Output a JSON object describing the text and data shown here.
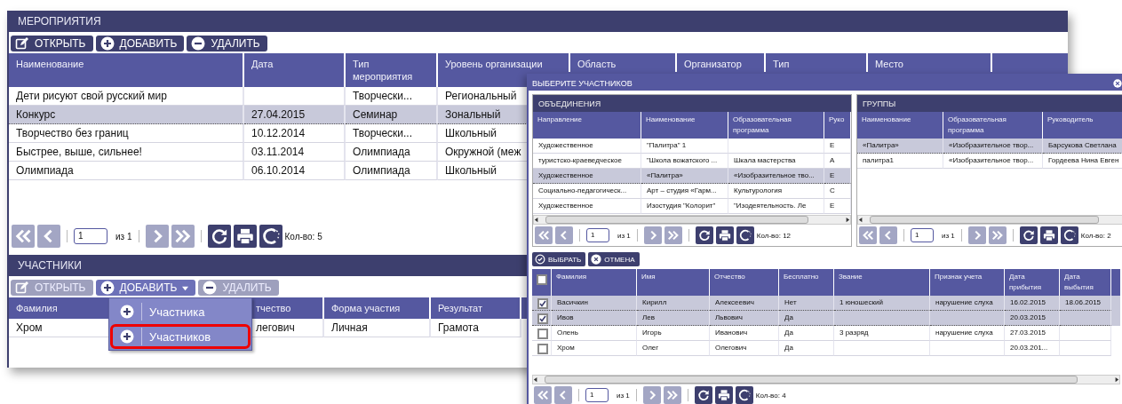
{
  "events_window": {
    "title": "МЕРОПРИЯТИЯ",
    "toolbar": [
      {
        "label": "ОТКРЫТЬ",
        "kind": "edit",
        "disabled": false,
        "has_menu": false
      },
      {
        "label": "ДОБАВИТЬ",
        "kind": "add",
        "disabled": false,
        "has_menu": false
      },
      {
        "label": "УДАЛИТЬ",
        "kind": "remove",
        "disabled": false,
        "has_menu": false
      }
    ],
    "table": {
      "columns": [
        "Наименование",
        "Дата",
        "Тип мероприятия",
        "Уровень организации",
        "Область",
        "Организатор",
        "Тип",
        "Место"
      ],
      "rows": [
        {
          "cells": [
            "Дети рисуют свой русский мир",
            null,
            "Творчески...",
            "Региональный"
          ],
          "selected": false
        },
        {
          "cells": [
            "Конкурс",
            "27.04.2015",
            "Семинар",
            "Зональный"
          ],
          "selected": true
        },
        {
          "cells": [
            "Творчество без границ",
            "10.12.2014",
            "Творчески...",
            "Школьный"
          ],
          "selected": false
        },
        {
          "cells": [
            "Быстрее, выше, сильнее!",
            "03.11.2014",
            "Олимпиада",
            "Окружной (меж"
          ],
          "selected": false
        },
        {
          "cells": [
            "Олимпиада",
            "06.10.2014",
            "Олимпиада",
            "Школьный"
          ],
          "selected": false
        }
      ]
    },
    "pager": {
      "page": "1",
      "of": "из 1",
      "count": "Кол-во: 5"
    }
  },
  "participants_window": {
    "title": "УЧАСТНИКИ",
    "toolbar": [
      {
        "label": "ОТКРЫТЬ",
        "kind": "edit",
        "disabled": true,
        "has_menu": false
      },
      {
        "label": "ДОБАВИТЬ",
        "kind": "add",
        "disabled": false,
        "has_menu": true
      },
      {
        "label": "УДАЛИТЬ",
        "kind": "remove",
        "disabled": true,
        "has_menu": false
      }
    ],
    "table": {
      "columns": [
        "Фамилия",
        "тчество",
        "Форма участия",
        "Результат"
      ],
      "rows": [
        {
          "cells": [
            "Хром",
            "легович",
            "Личная",
            "Грамота"
          ],
          "selected": false
        }
      ]
    },
    "dropdown_menu": {
      "items": [
        {
          "label": "Участника",
          "highlighted": false
        },
        {
          "label": "Участников",
          "highlighted": true
        }
      ]
    }
  },
  "dialog": {
    "title": "ВЫБЕРИТЕ УЧАСТНИКОВ",
    "panels": [
      {
        "title": "ОБЪЕДИНЕНИЯ",
        "columns": [
          "Направление",
          "Наименование",
          "Образовательная программа",
          "Руко"
        ],
        "rows": [
          {
            "cells": [
              "Художественное",
              "\"Палитра\" 1",
              null,
              "Е"
            ],
            "selected": false
          },
          {
            "cells": [
              "туристско-краеведческое",
              "\"Школа вожатского ...",
              "Шкала мастерства",
              "А"
            ],
            "selected": false
          },
          {
            "cells": [
              "Художественное",
              "«Палитра»",
              "«Изобразительное тво...",
              "Е"
            ],
            "selected": true
          },
          {
            "cells": [
              "Социально-педагогическ...",
              "Арт – студия «Гарм...",
              "Культурология",
              "С"
            ],
            "selected": false
          },
          {
            "cells": [
              "Художественное",
              "Изостудия \"Колорит\"",
              "\"Изодеятельность. Ле",
              "Е"
            ],
            "selected": false
          }
        ],
        "pager": {
          "page": "1",
          "of": "из 1",
          "count": "Кол-во: 12"
        }
      },
      {
        "title": "ГРУППЫ",
        "columns": [
          "Наименование",
          "Образовательная программа",
          "Руководитель"
        ],
        "rows": [
          {
            "cells": [
              "«Палитра»",
              "«Изобразительное твор...",
              "Барсукова Светлана"
            ],
            "selected": true
          },
          {
            "cells": [
              "палитра1",
              "«Изобразительное твор...",
              "Гордеева Нина Евген"
            ],
            "selected": false
          }
        ],
        "pager": {
          "page": "1",
          "of": "из 1",
          "count": "Кол-во: 2"
        }
      }
    ],
    "actions": [
      {
        "label": "ВЫБРАТЬ",
        "kind": "confirm"
      },
      {
        "label": "ОТМЕНА",
        "kind": "cancel"
      }
    ],
    "table": {
      "select_all_checked": false,
      "columns": [
        "Фамилия",
        "Имя",
        "Отчество",
        "Бесплатно",
        "Звание",
        "Признак учета",
        "Дата прибытия",
        "Дата выбытия"
      ],
      "rows": [
        {
          "cells": [
            "Васичкин",
            "Кирилл",
            "Алексеевич",
            "Нет",
            "1 юношеский",
            "нарушение слуха",
            "16.02.2015",
            "18.06.2015"
          ],
          "checked": true,
          "selected": true
        },
        {
          "cells": [
            "Ивов",
            "Лев",
            "Львович",
            "Да",
            null,
            null,
            "20.03.2015",
            null
          ],
          "checked": true,
          "selected": true
        },
        {
          "cells": [
            "Олень",
            "Игорь",
            "Иванович",
            "Да",
            "3 разряд",
            "нарушение слуха",
            "27.03.2015",
            null
          ],
          "checked": false,
          "selected": false
        },
        {
          "cells": [
            "Хром",
            "Олег",
            "Олегович",
            "Да",
            null,
            null,
            "20.03.201...",
            null
          ],
          "checked": false,
          "selected": false
        }
      ]
    },
    "pager": {
      "page": "1",
      "of": "из 1",
      "count": "Кол-во: 4"
    }
  }
}
